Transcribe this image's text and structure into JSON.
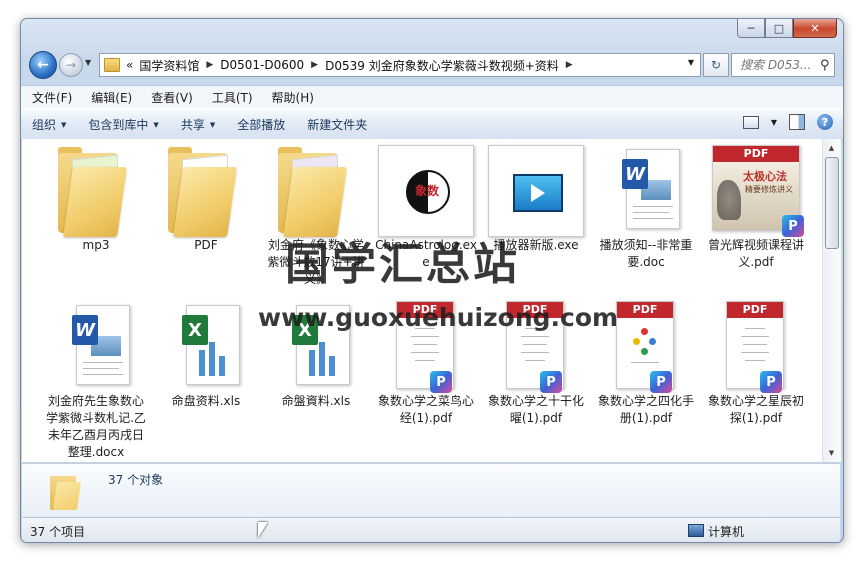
{
  "window": {
    "caption_buttons": {
      "minimize": "─",
      "maximize": "□",
      "close": "✕"
    }
  },
  "nav": {
    "back_glyph": "←",
    "forward_glyph": "→",
    "chevron_left": "«",
    "breadcrumbs": [
      "国学资料馆",
      "D0501-D0600",
      "D0539 刘金府象数心学紫薇斗数视频+资料"
    ],
    "search_placeholder": "搜索 D053..."
  },
  "menu": [
    "文件(F)",
    "编辑(E)",
    "查看(V)",
    "工具(T)",
    "帮助(H)"
  ],
  "toolbar": {
    "organize": "组织",
    "include_library": "包含到库中",
    "share": "共享",
    "play_all": "全部播放",
    "new_folder": "新建文件夹",
    "help": "?"
  },
  "files": [
    {
      "name": "mp3",
      "type": "folder"
    },
    {
      "name": "PDF",
      "type": "folder"
    },
    {
      "name": "刘金府《象数心学紫微斗数17讲+讲义》",
      "type": "folder"
    },
    {
      "name": "ChinaAstrolog.exe",
      "type": "exe"
    },
    {
      "name": "播放器新版.exe",
      "type": "exe"
    },
    {
      "name": "播放须知--非常重要.doc",
      "type": "doc"
    },
    {
      "name": "曾光辉视频课程讲义.pdf",
      "type": "pdf"
    },
    {
      "name": "刘金府先生象数心学紫微斗数札记.乙未年乙酉月丙戌日整理.docx",
      "type": "docx"
    },
    {
      "name": "命盘资料.xls",
      "type": "xls"
    },
    {
      "name": "命盤資料.xls",
      "type": "xls"
    },
    {
      "name": "象数心学之菜鸟心经(1).pdf",
      "type": "pdf"
    },
    {
      "name": "象数心学之十干化曜(1).pdf",
      "type": "pdf"
    },
    {
      "name": "象数心学之四化手册(1).pdf",
      "type": "pdf"
    },
    {
      "name": "象数心学之星辰初探(1).pdf",
      "type": "pdf"
    }
  ],
  "thumb_text": {
    "pdf": "PDF",
    "pdf_cover_title": "太极心法",
    "pdf_cover_sub": "精要修炼讲义",
    "p_badge": "P",
    "xl_letter": "X",
    "wd_letter": "W",
    "yinyang_text": "象数"
  },
  "details": {
    "count": "37 个对象"
  },
  "status": {
    "items": "37 个项目",
    "computer": "计算机"
  },
  "watermark": {
    "line1": "国学汇总站",
    "line2": "www.guoxuehuizong.com"
  }
}
